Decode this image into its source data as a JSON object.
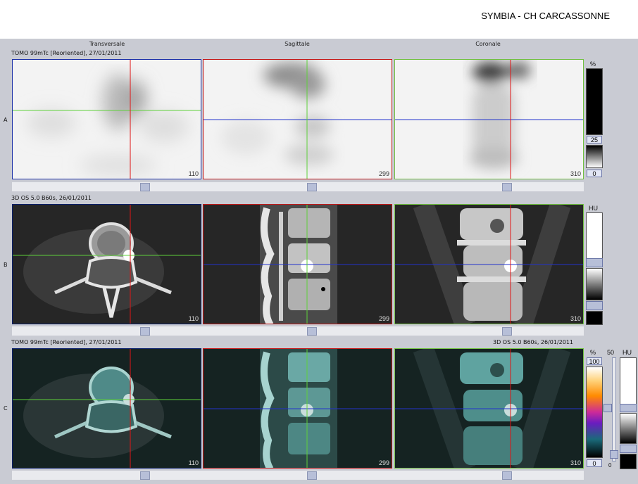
{
  "header": {
    "hospital": "SYMBIA - CH CARCASSONNE"
  },
  "view_titles": [
    "Transversale",
    "Sagittale",
    "Coronale"
  ],
  "rows": [
    {
      "letter": "A",
      "series_left": "TOMO 99mTc [Reoriented], 27/01/2011",
      "series_right": "",
      "slices": [
        "110",
        "299",
        "310"
      ]
    },
    {
      "letter": "B",
      "series_left": "3D  OS  5.0  B60s, 26/01/2011",
      "series_right": "",
      "slices": [
        "110",
        "299",
        "310"
      ]
    },
    {
      "letter": "C",
      "series_left": "TOMO 99mTc [Reoriented], 27/01/2011",
      "series_right": "3D  OS  5.0  B60s, 26/01/2011",
      "slices": [
        "110",
        "299",
        "310"
      ]
    }
  ],
  "scales": {
    "a": {
      "unit": "%",
      "upper_value": "25",
      "lower_value": "0"
    },
    "b": {
      "unit": "HU"
    },
    "c": {
      "unit_pct": "%",
      "top_value": "100",
      "bottom_value": "0",
      "blend_value": "50",
      "blend_bottom": "0",
      "unit_hu": "HU"
    }
  },
  "colors": {
    "crosshair_red": "#e01515",
    "crosshair_green": "#5ed03a",
    "crosshair_blue": "#2233cc",
    "panel": "#c9cbd3"
  }
}
